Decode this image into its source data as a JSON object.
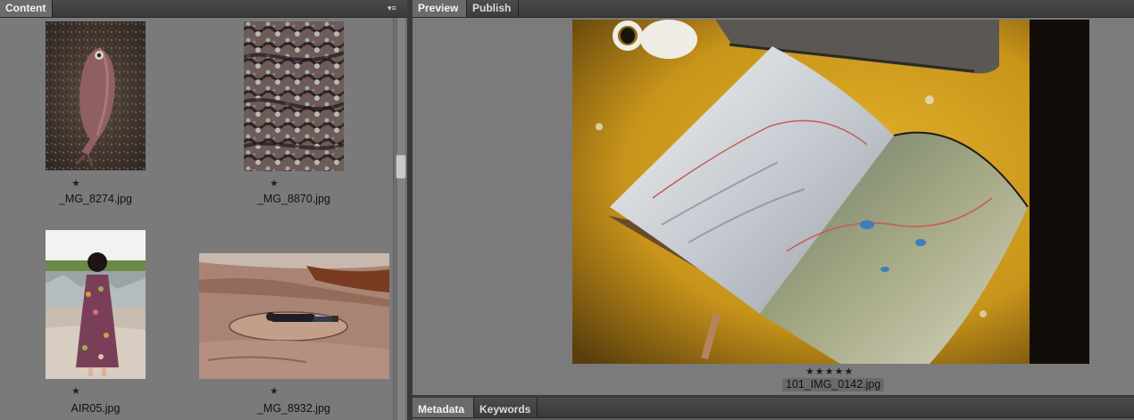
{
  "content_panel": {
    "tab_label": "Content",
    "menu_icon": "panel-menu-icon",
    "items": [
      {
        "filename": "_MG_8274.jpg",
        "rating": "★",
        "image": "fish-on-gravel"
      },
      {
        "filename": "_MG_8870.jpg",
        "rating": "★",
        "image": "lichen-rock"
      },
      {
        "filename": "AIR05.jpg",
        "rating": "★",
        "image": "woman-floral-dress"
      },
      {
        "filename": "_MG_8932.jpg",
        "rating": "★",
        "image": "man-lying-on-rock"
      }
    ]
  },
  "preview_panel": {
    "tabs": [
      "Preview",
      "Publish"
    ],
    "active_tab": "Preview",
    "rating": "★★★★★",
    "filename": "101_IMG_0142.jpg",
    "image": "map-book-on-yellow-table"
  },
  "bottom_panel": {
    "tabs": [
      "Metadata",
      "Keywords"
    ],
    "active_tab": "Metadata"
  }
}
